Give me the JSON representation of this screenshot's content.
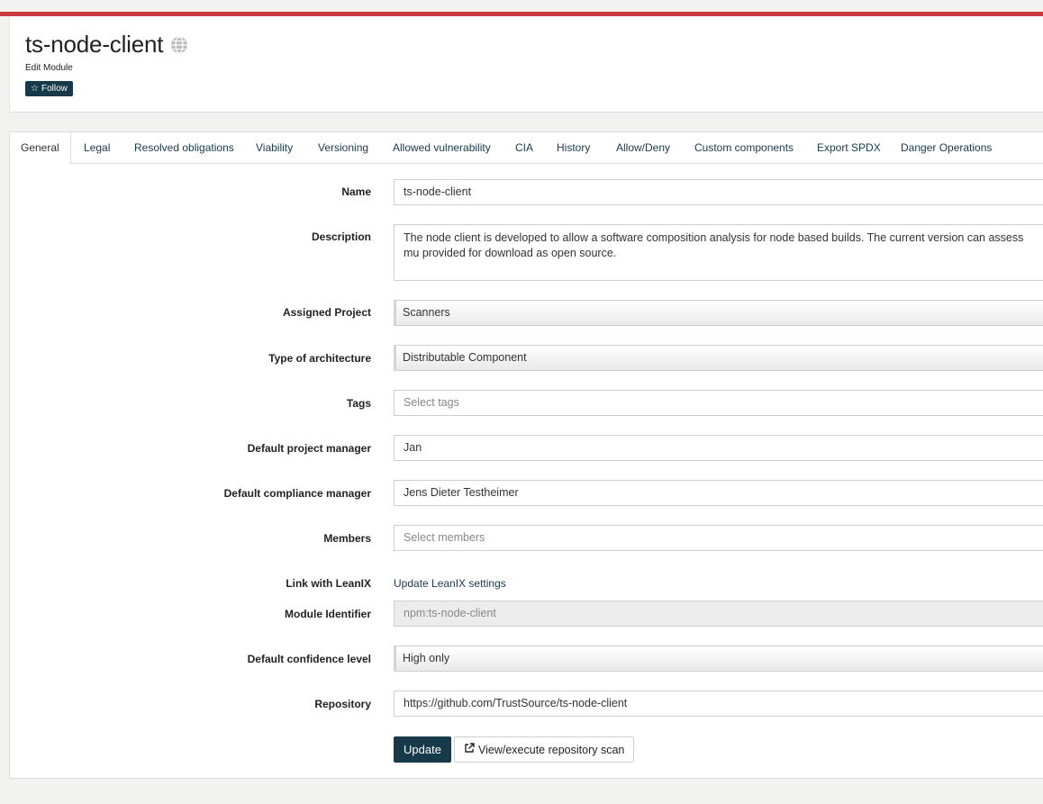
{
  "header": {
    "title": "ts-node-client",
    "subtitle": "Edit Module",
    "follow_label": "Follow",
    "globe_icon": "globe-icon"
  },
  "tabs": [
    {
      "label": "General",
      "active": true
    },
    {
      "label": "Legal"
    },
    {
      "label": "Resolved obligations"
    },
    {
      "label": "Viability"
    },
    {
      "label": "Versioning"
    },
    {
      "label": "Allowed vulnerability"
    },
    {
      "label": "CIA"
    },
    {
      "label": "History"
    },
    {
      "label": "Allow/Deny"
    },
    {
      "label": "Custom components"
    },
    {
      "label": "Export SPDX"
    },
    {
      "label": "Danger Operations"
    }
  ],
  "form": {
    "name": {
      "label": "Name",
      "value": "ts-node-client"
    },
    "description": {
      "label": "Description",
      "value": "The node client is developed to allow a software composition analysis for node based builds. The current version can assess mu provided for download as open source."
    },
    "assigned_project": {
      "label": "Assigned Project",
      "value": "Scanners"
    },
    "architecture": {
      "label": "Type of architecture",
      "value": "Distributable Component"
    },
    "tags": {
      "label": "Tags",
      "placeholder": "Select tags"
    },
    "project_manager": {
      "label": "Default project manager",
      "value": "Jan"
    },
    "compliance_manager": {
      "label": "Default compliance manager",
      "value": "Jens Dieter Testheimer"
    },
    "members": {
      "label": "Members",
      "placeholder": "Select members"
    },
    "leanix": {
      "label": "Link with LeanIX",
      "link": "Update LeanIX settings"
    },
    "module_identifier": {
      "label": "Module Identifier",
      "value": "npm:ts-node-client"
    },
    "confidence": {
      "label": "Default confidence level",
      "value": "High only"
    },
    "repository": {
      "label": "Repository",
      "value": "https://github.com/TrustSource/ts-node-client"
    }
  },
  "actions": {
    "update_label": "Update",
    "scan_label": "View/execute repository scan"
  },
  "colors": {
    "accent": "#c9393e",
    "primary": "#173a4a"
  }
}
